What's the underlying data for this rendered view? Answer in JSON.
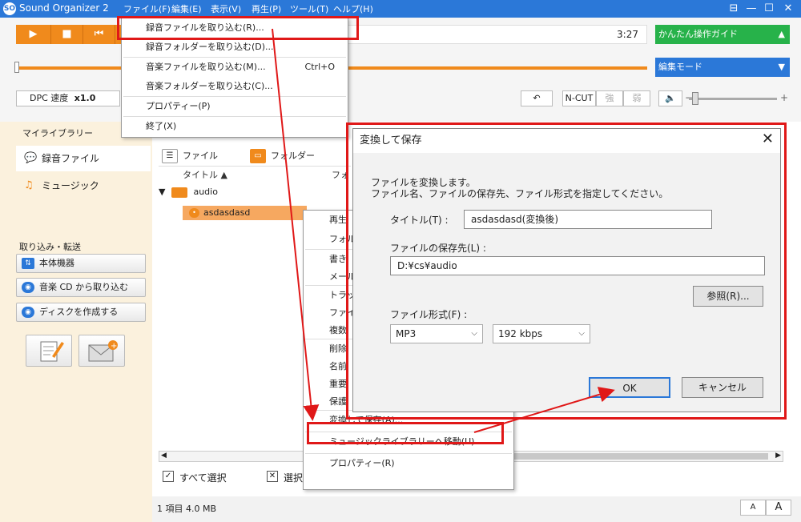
{
  "app": {
    "title": "Sound Organizer 2"
  },
  "menubar": [
    "ファイル(F)",
    "編集(E)",
    "表示(V)",
    "再生(P)",
    "ツール(T)",
    "ヘルプ(H)"
  ],
  "player": {
    "time": "3:27",
    "easy_guide": "かんたん操作ガイド",
    "edit_mode": "編集モード",
    "dpc_label": "DPC 速度",
    "dpc_value": "x1.0",
    "ncut": "N-CUT",
    "strong": "強",
    "weak": "弱",
    "vol_minus": "−",
    "vol_plus": "+"
  },
  "sidebar": {
    "my_library": "マイライブラリー",
    "tabs": [
      "録音ファイル",
      "ミュージック"
    ],
    "import_label": "取り込み・転送",
    "buttons": [
      "本体機器",
      "音楽 CD から取り込む",
      "ディスクを作成する"
    ]
  },
  "filelist": {
    "view_file": "ファイル",
    "view_folder": "フォルダー",
    "col_title": "タイトル ▲",
    "col_folder": "フォ",
    "folder_name": "audio",
    "file_name": "asdasdasd",
    "select_all": "すべて選択",
    "deselect": "選択",
    "status": "1 項目 4.0 MB",
    "font_small": "A",
    "font_large": "A"
  },
  "file_menu": [
    {
      "label": "録音ファイルを取り込む(R)...",
      "shortcut": ""
    },
    {
      "label": "録音フォルダーを取り込む(D)...",
      "shortcut": ""
    },
    {
      "label": "音楽ファイルを取り込む(M)...",
      "shortcut": "Ctrl+O"
    },
    {
      "label": "音楽フォルダーを取り込む(C)...",
      "shortcut": ""
    },
    {
      "label": "プロパティー(P)",
      "shortcut": ""
    },
    {
      "label": "終了(X)",
      "shortcut": ""
    }
  ],
  "context_menu": [
    "再生",
    "フォルダ",
    "書き",
    "メール",
    "トラック",
    "ファイ",
    "複数",
    "削除",
    "名前",
    "重要",
    "保護",
    "変換して保存(A)...",
    "ミュージックライブラリーへ移動(U)",
    "プロパティー(R)"
  ],
  "dialog": {
    "title": "変換して保存",
    "close": "✕",
    "desc1": "ファイルを変換します。",
    "desc2": "ファイル名、ファイルの保存先、ファイル形式を指定してください。",
    "title_label": "タイトル(T) :",
    "title_value": "asdasdasd(変換後)",
    "dest_label": "ファイルの保存先(L) :",
    "dest_value": "D:¥cs¥audio",
    "browse": "参照(R)...",
    "format_label": "ファイル形式(F) :",
    "format_value": "MP3",
    "bitrate_value": "192 kbps",
    "ok": "OK",
    "cancel": "キャンセル"
  },
  "colors": {
    "accent": "#f08a1c",
    "titlebar": "#2b78d8",
    "green": "#27b24a",
    "highlight": "#e01818"
  }
}
